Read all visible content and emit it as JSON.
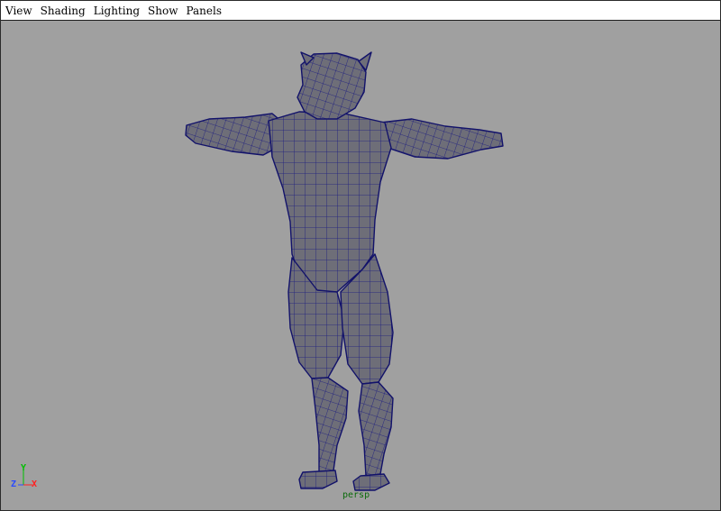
{
  "menubar": {
    "items": [
      {
        "label": "View"
      },
      {
        "label": "Shading"
      },
      {
        "label": "Lighting"
      },
      {
        "label": "Show"
      },
      {
        "label": "Panels"
      }
    ]
  },
  "viewport": {
    "camera": "persp",
    "axis": {
      "y": "Y",
      "z": "Z",
      "x": "X"
    },
    "colors": {
      "background": "#a0a0a0",
      "mesh_fill": "#6e6e78",
      "wireframe": "#1a1a80"
    }
  }
}
